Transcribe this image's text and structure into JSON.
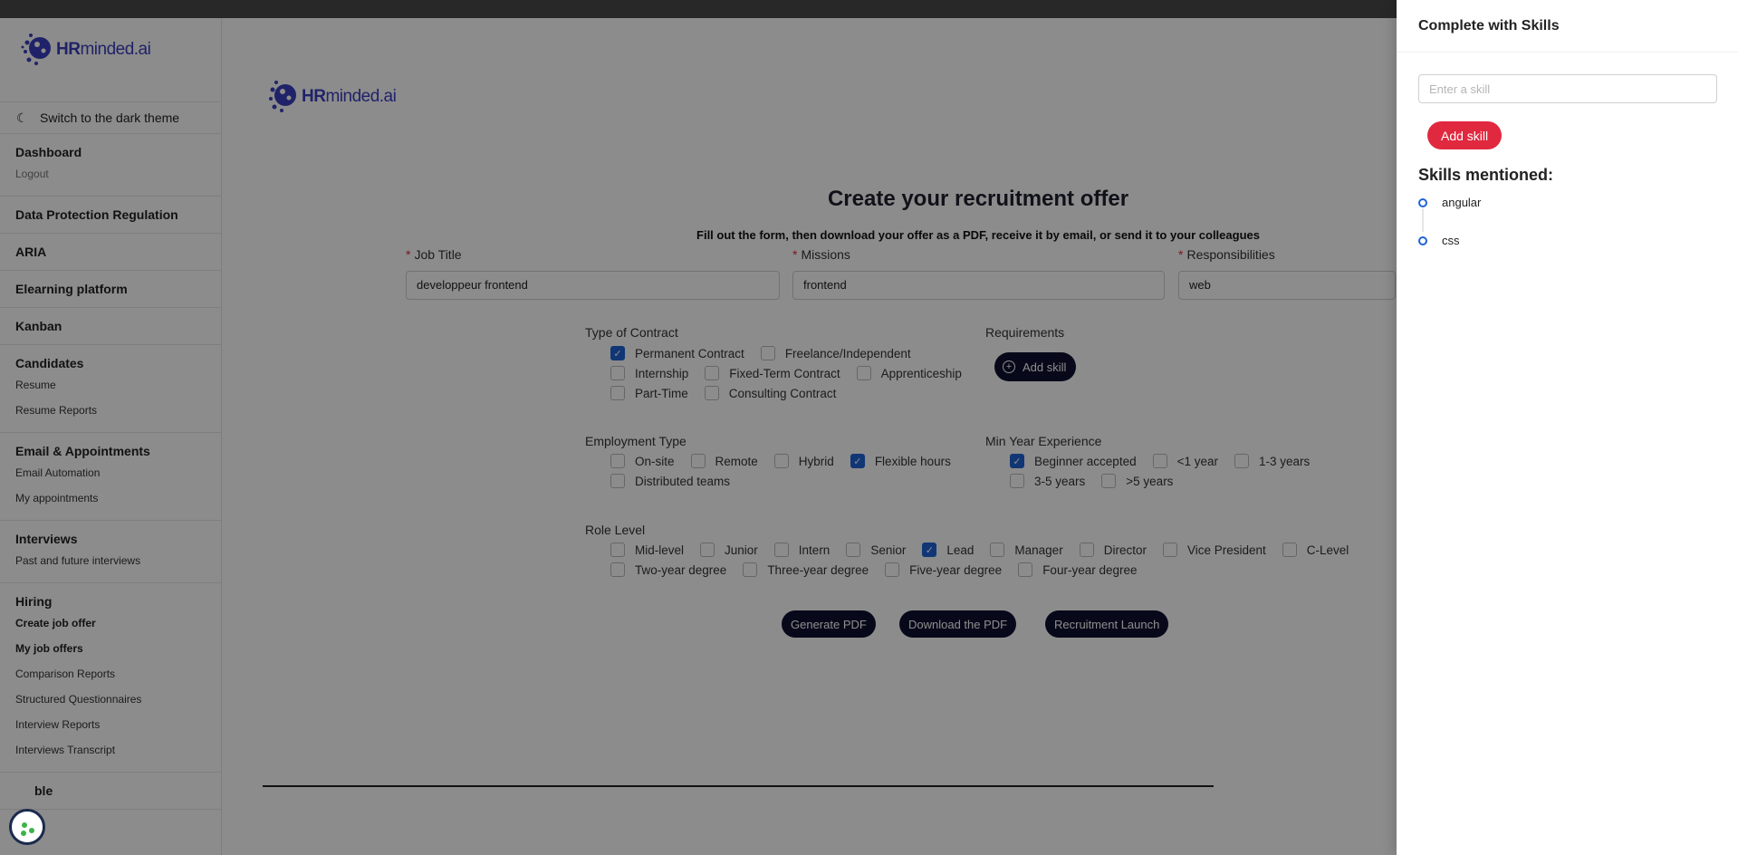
{
  "brand": {
    "name_bold": "HR",
    "name_rest": "minded.ai"
  },
  "sidebar": {
    "theme_toggle": "Switch to the dark theme",
    "groups": [
      {
        "title": "Dashboard",
        "items": [
          "Logout"
        ]
      },
      {
        "title": "Data Protection Regulation",
        "items": []
      },
      {
        "title": "ARIA",
        "items": []
      },
      {
        "title": "Elearning platform",
        "items": []
      },
      {
        "title": "Kanban",
        "items": []
      },
      {
        "title": "Candidates",
        "items": [
          "Resume",
          "Resume Reports"
        ]
      },
      {
        "title": "Email & Appointments",
        "items": [
          "Email Automation",
          "My appointments"
        ]
      },
      {
        "title": "Interviews",
        "items": [
          "Past and future interviews"
        ]
      },
      {
        "title": "Hiring",
        "items": [
          "Create job offer",
          "My job offers",
          "Comparison Reports",
          "Structured Questionnaires",
          "Interview Reports",
          "Interviews Transcript"
        ]
      },
      {
        "title": "ble",
        "items": []
      }
    ]
  },
  "form": {
    "title": "Create your recruitment offer",
    "subtitle": "Fill out the form, then download your offer as a PDF, receive it by email, or send it to your colleagues",
    "required_mark": "*",
    "job_title_label": "Job Title",
    "job_title_value": "developpeur frontend",
    "missions_label": "Missions",
    "missions_value": "frontend",
    "responsibilities_label": "Responsibilities",
    "responsibilities_value": "web",
    "contract_label": "Type of Contract",
    "contract_rows": [
      [
        {
          "label": "Permanent Contract",
          "checked": true
        },
        {
          "label": "Freelance/Independent",
          "checked": false
        }
      ],
      [
        {
          "label": "Internship",
          "checked": false
        },
        {
          "label": "Fixed-Term Contract",
          "checked": false
        },
        {
          "label": "Apprenticeship",
          "checked": false
        }
      ],
      [
        {
          "label": "Part-Time",
          "checked": false
        },
        {
          "label": "Consulting Contract",
          "checked": false
        }
      ]
    ],
    "requirements_label": "Requirements",
    "add_skill_label": "Add skill",
    "employment_label": "Employment Type",
    "employment_rows": [
      [
        {
          "label": "On-site",
          "checked": false
        },
        {
          "label": "Remote",
          "checked": false
        },
        {
          "label": "Hybrid",
          "checked": false
        },
        {
          "label": "Flexible hours",
          "checked": true
        }
      ],
      [
        {
          "label": "Distributed teams",
          "checked": false
        }
      ]
    ],
    "experience_label": "Min Year Experience",
    "experience_rows": [
      [
        {
          "label": "Beginner accepted",
          "checked": true
        },
        {
          "label": "<1 year",
          "checked": false
        },
        {
          "label": "1-3 years",
          "checked": false
        }
      ],
      [
        {
          "label": "3-5 years",
          "checked": false
        },
        {
          "label": ">5 years",
          "checked": false
        }
      ]
    ],
    "role_label": "Role Level",
    "role_rows": [
      [
        {
          "label": "Mid-level",
          "checked": false
        },
        {
          "label": "Junior",
          "checked": false
        },
        {
          "label": "Intern",
          "checked": false
        },
        {
          "label": "Senior",
          "checked": false
        },
        {
          "label": "Lead",
          "checked": true
        },
        {
          "label": "Manager",
          "checked": false
        },
        {
          "label": "Director",
          "checked": false
        },
        {
          "label": "Vice President",
          "checked": false
        },
        {
          "label": "C-Level",
          "checked": false
        }
      ],
      [
        {
          "label": "Two-year degree",
          "checked": false
        },
        {
          "label": "Three-year degree",
          "checked": false
        },
        {
          "label": "Five-year degree",
          "checked": false
        },
        {
          "label": "Four-year degree",
          "checked": false
        }
      ]
    ],
    "buttons": {
      "generate": "Generate PDF",
      "download": "Download the PDF",
      "launch": "Recruitment Launch"
    }
  },
  "drawer": {
    "title": "Complete with Skills",
    "input_placeholder": "Enter a skill",
    "add_button": "Add skill",
    "mentioned_title": "Skills mentioned:",
    "skills": [
      "angular",
      "css"
    ]
  },
  "colors": {
    "accent": "#1f63d6",
    "danger": "#e0283f",
    "dark_button": "#0e1130",
    "brand": "#3b3fbf"
  },
  "icons": {
    "theme": "moon-icon",
    "add_skill": "plus-circle-icon",
    "cookie": "cookie-icon",
    "logo": "brain-logo-icon"
  }
}
